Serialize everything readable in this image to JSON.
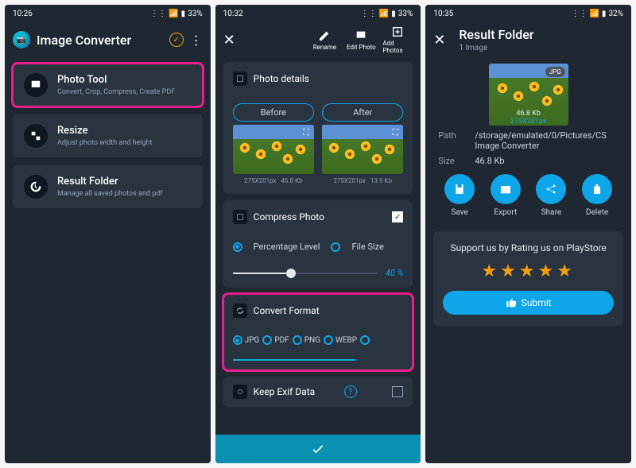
{
  "screen1": {
    "time": "10:26",
    "battery": "33%",
    "app_title": "Image Converter",
    "cards": [
      {
        "title": "Photo Tool",
        "subtitle": "Convert, Crop, Compress, Create PDF"
      },
      {
        "title": "Resize",
        "subtitle": "Adjust photo width and height"
      },
      {
        "title": "Result Folder",
        "subtitle": "Manage all saved photos and pdf"
      }
    ]
  },
  "screen2": {
    "time": "10:32",
    "battery": "33%",
    "toolbar": {
      "rename": "Rename",
      "edit": "Edit Photo",
      "add": "Add Photos"
    },
    "photo_details_title": "Photo details",
    "before_label": "Before",
    "after_label": "After",
    "before_dim": "275X201px",
    "before_size": "46.8 Kb",
    "after_dim": "275X201px",
    "after_size": "13.9 Kb",
    "compress_title": "Compress Photo",
    "radio_pct": "Percentage Level",
    "radio_fs": "File Size",
    "pct_value": "40 %",
    "convert_title": "Convert Format",
    "formats": [
      "JPG",
      "PDF",
      "PNG",
      "WEBP"
    ],
    "exif_title": "Keep Exif Data"
  },
  "screen3": {
    "time": "10:35",
    "battery": "32%",
    "title": "Result Folder",
    "subtitle": "1 Image",
    "thumb_badge": "JPG",
    "thumb_size": "46.8 Kb",
    "thumb_dim": "275X201px",
    "path_label": "Path",
    "path_value": "/storage/emulated/0/Pictures/CS Image Converter",
    "size_label": "Size",
    "size_value": "46.8 Kb",
    "actions": {
      "save": "Save",
      "export": "Export",
      "share": "Share",
      "delete": "Delete"
    },
    "rate_text": "Support us by Rating us on PlayStore",
    "submit": "Submit"
  }
}
